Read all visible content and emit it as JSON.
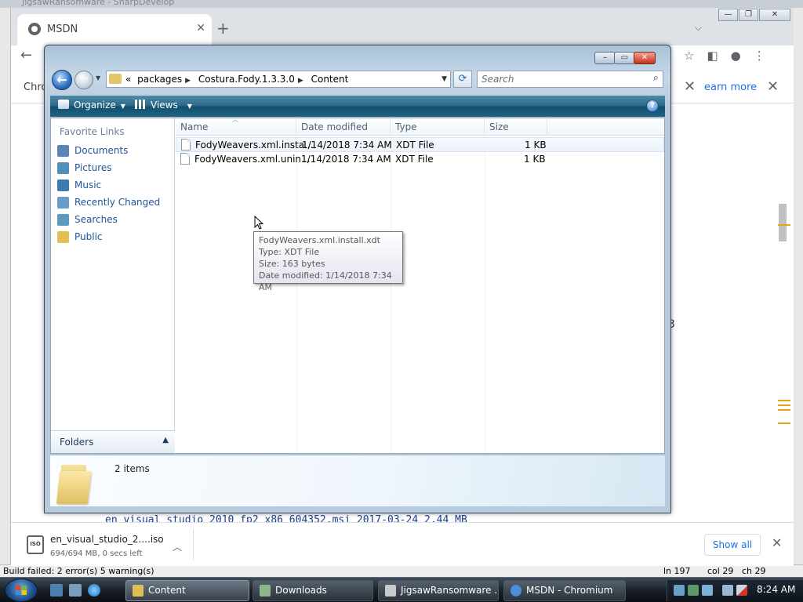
{
  "ide": {
    "title": "JigsawRansomware - SharpDevelop",
    "status_left": "Build failed: 2 error(s) 5 warning(s)",
    "status_ln": "ln 197",
    "status_col": "col 29",
    "status_ch": "ch 29"
  },
  "browser": {
    "tab_title": "MSDN",
    "infobar_left": "Chro",
    "infobar_learn_more": "earn more",
    "page_line": "en_visual_studio_2010_fp2_x86_604352.msi     2017-03-24      2.44 MB",
    "stray_glyph": "3",
    "download": {
      "filename": "en_visual_studio_2....iso",
      "status": "694/694 MB, 0 secs left",
      "icon_text": "ISO",
      "show_all": "Show all"
    }
  },
  "explorer": {
    "breadcrumbs": [
      "packages",
      "Costura.Fody.1.3.3.0",
      "Content"
    ],
    "breadcrumb_prefix": "«",
    "search_placeholder": "Search",
    "toolbar": {
      "organize": "Organize",
      "views": "Views"
    },
    "nav": {
      "header": "Favorite Links",
      "links": [
        {
          "label": "Documents",
          "icon": "documents-icon",
          "color": "#5a86b5"
        },
        {
          "label": "Pictures",
          "icon": "pictures-icon",
          "color": "#4f8fb8"
        },
        {
          "label": "Music",
          "icon": "music-icon",
          "color": "#3c7ab0"
        },
        {
          "label": "Recently Changed",
          "icon": "recently-changed-icon",
          "color": "#6b9cc7"
        },
        {
          "label": "Searches",
          "icon": "searches-icon",
          "color": "#5c9ac2"
        },
        {
          "label": "Public",
          "icon": "public-folder-icon",
          "color": "#e2bf55"
        }
      ],
      "folders_label": "Folders"
    },
    "columns": [
      "Name",
      "Date modified",
      "Type",
      "Size"
    ],
    "rows": [
      {
        "name": "FodyWeavers.xml.insta...",
        "date": "1/14/2018 7:34 AM",
        "type": "XDT File",
        "size": "1 KB"
      },
      {
        "name": "FodyWeavers.xml.unin...",
        "date": "1/14/2018 7:34 AM",
        "type": "XDT File",
        "size": "1 KB"
      }
    ],
    "tooltip": {
      "line1": "FodyWeavers.xml.install.xdt",
      "line2": "Type: XDT File",
      "line3": "Size: 163 bytes",
      "line4": "Date modified: 1/14/2018 7:34 AM"
    },
    "item_count": "2 items"
  },
  "taskbar": {
    "buttons": [
      {
        "label": "Content",
        "color": "#e2bf55"
      },
      {
        "label": "Downloads",
        "color": "#8fb58a"
      },
      {
        "label": "JigsawRansomware ...",
        "color": "#c9c9c9"
      },
      {
        "label": "MSDN - Chromium",
        "color": "#4a8fd8"
      }
    ],
    "clock": "8:24 AM"
  }
}
